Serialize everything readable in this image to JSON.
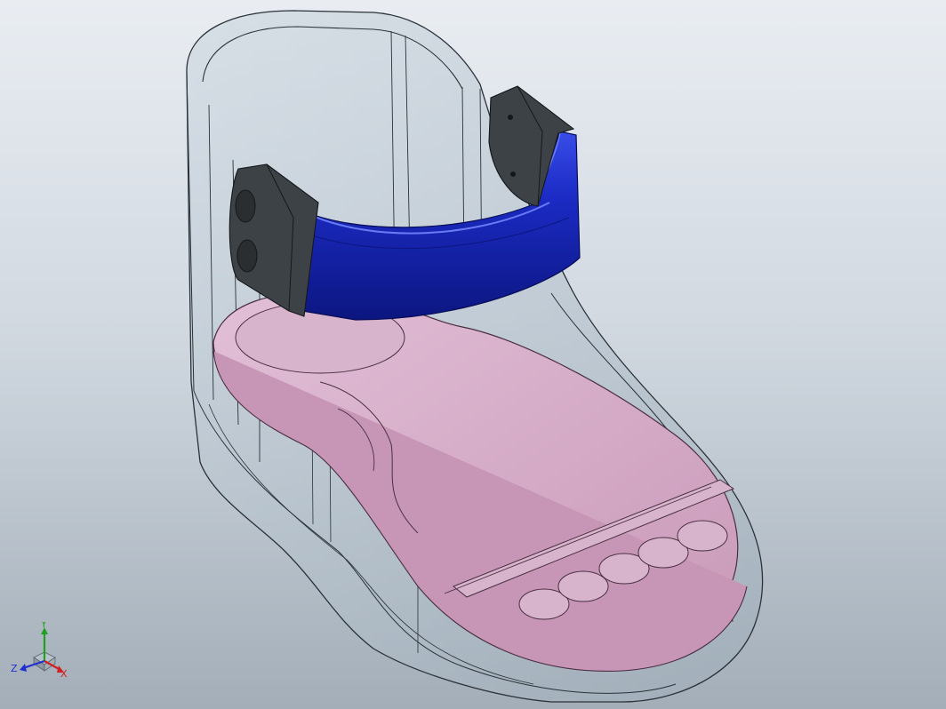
{
  "viewport": {
    "colors": {
      "bg_top": "#e9edf2",
      "bg_bottom": "#a3aeb8",
      "shell_fill": "#c4d0da",
      "shell_edge": "#2a3138",
      "insole_fill": "#d3a9c5",
      "insole_shade": "#c293b4",
      "strap_fill": "#1b2bc4",
      "strap_dark": "#0c1680",
      "buckle_fill": "#3d4246"
    }
  },
  "model": {
    "shell_icon": "translucent-boot-shell",
    "insole_icon": "pink-insole",
    "strap_icon": "blue-strap",
    "buckle_icon": "dark-buckle"
  },
  "triad": {
    "x_label": "X",
    "y_label": "Y",
    "z_label": "Z",
    "colors": {
      "x": "#d02020",
      "y": "#20a020",
      "z": "#2030d0"
    }
  }
}
